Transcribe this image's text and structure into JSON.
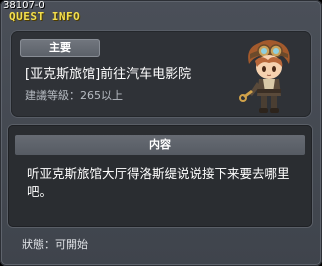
{
  "window": {
    "quest_id": "38107-0",
    "title": "QUEST INFO"
  },
  "quest": {
    "badge": "主要",
    "name": "[亚克斯旅馆]前往汽车电影院",
    "level": "建議等級：265以上"
  },
  "content": {
    "header": "内容",
    "text": "听亚克斯旅馆大厅得洛斯缇说说接下来要去哪里吧。"
  },
  "status": {
    "text": "狀態：可開始"
  },
  "colors": {
    "title": "#f3df4e",
    "window_bg": "#4a4f58",
    "panel_bg": "#2f3237"
  },
  "icons": {
    "portrait": "npc-character-portrait"
  }
}
